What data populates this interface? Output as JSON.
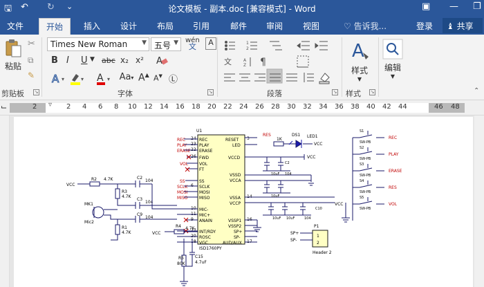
{
  "titlebar": {
    "title": "论文模板 - 副本.doc [兼容模式] - Word",
    "save_glyph": "🖫",
    "undo_glyph": "↶",
    "redo_glyph": "↻",
    "customize_glyph": "⌄",
    "ribbon_display_glyph": "▣",
    "minimize_glyph": "—",
    "restore_glyph": "❐"
  },
  "tabs": [
    "文件",
    "开始",
    "插入",
    "设计",
    "布局",
    "引用",
    "邮件",
    "审阅",
    "视图"
  ],
  "active_tab": "开始",
  "tell_me": "♡ 告诉我...",
  "signin": "登录",
  "share": "共享",
  "clipboard": {
    "paste": "粘贴",
    "group": "剪贴板"
  },
  "font": {
    "name": "Times New Roman",
    "size": "五号",
    "wen": "wén",
    "group": "字体",
    "bold": "B",
    "italic": "I",
    "underline": "U",
    "strike": "abc",
    "sub": "x₂",
    "sup": "x²",
    "fontcolor": "A",
    "case": "Aa",
    "grow": "A",
    "shrink": "A"
  },
  "paragraph": {
    "group": "段落"
  },
  "styles": {
    "label": "样式",
    "group": "样式"
  },
  "editing": {
    "label": "编辑"
  },
  "ruler_numbers": [
    "2",
    "2",
    "4",
    "6",
    "8",
    "10",
    "12",
    "14",
    "16",
    "18",
    "20",
    "22",
    "24",
    "26",
    "28",
    "30",
    "32",
    "34",
    "36",
    "38",
    "40",
    "42",
    "44",
    "46",
    "48"
  ],
  "schematic": {
    "chip_name": "U1",
    "chip_part": "ISD1760PY",
    "left_pins": [
      {
        "num": "24",
        "name": "REC",
        "net": "REC"
      },
      {
        "num": "23",
        "name": "PLAY",
        "net": "PLAY"
      },
      {
        "num": "22",
        "name": "ERASE",
        "net": "ERASE"
      },
      {
        "num": "26",
        "name": "FWD",
        "net": ""
      },
      {
        "num": "",
        "name": "VOL",
        "net": "VOL"
      },
      {
        "num": "",
        "name": "FT",
        "net": ""
      },
      {
        "num": "",
        "name": "SS",
        "net": "SS"
      },
      {
        "num": "6",
        "name": "SCLK",
        "net": "SCLK"
      },
      {
        "num": "",
        "name": "MOSI",
        "net": "MOSI"
      },
      {
        "num": "",
        "name": "MISO",
        "net": "MISO"
      },
      {
        "num": "10",
        "name": "MIC-",
        "net": ""
      },
      {
        "num": "11",
        "name": "MIC+",
        "net": ""
      },
      {
        "num": "9",
        "name": "ANAIN",
        "net": ""
      },
      {
        "num": "27",
        "name": "INT/RDY",
        "net": ""
      },
      {
        "num": "20",
        "name": "ROSC",
        "net": ""
      },
      {
        "num": "18",
        "name": "VGC",
        "net": ""
      }
    ],
    "right_pins": [
      {
        "num": "3",
        "name": "RESET"
      },
      {
        "num": "",
        "name": "LED"
      },
      {
        "num": "",
        "name": "VCCD"
      },
      {
        "num": "",
        "name": "VSSD"
      },
      {
        "num": "",
        "name": "VCCA"
      },
      {
        "num": "14",
        "name": "VSSA"
      },
      {
        "num": "",
        "name": "VCCP"
      },
      {
        "num": "16",
        "name": "VSSP1"
      },
      {
        "num": "",
        "name": "VSSP2"
      },
      {
        "num": "",
        "name": "SP+"
      },
      {
        "num": "",
        "name": "SP-"
      },
      {
        "num": "17",
        "name": "AUD/AUX"
      }
    ],
    "labels": {
      "vcc": "VCC",
      "r2": "R2",
      "r2v": "4.7K",
      "r3": "R3",
      "r3v": "4.7K",
      "r1": "R1",
      "r1v": "4.7K",
      "c2": "C2",
      "c2v": "104",
      "c3": "C3",
      "c3v": "104",
      "c9": "C9",
      "c9v": "104",
      "mk1": "MK1",
      "mic": "Mic2",
      "r4": "R4",
      "r4v": "4.7K",
      "r5": "R5",
      "r5v": "80K",
      "c15": "C15",
      "c15v": "4.7uF",
      "res": "RES",
      "r1k": "1K",
      "ds1": "DS1",
      "led": "LED1",
      "cap1": "10uF",
      "cap2": "104",
      "cap3": "10uF",
      "cap4": "10uF",
      "cap5": "104",
      "cap6": "10uF",
      "c10": "C10",
      "p1": "P1",
      "header": "Header 2",
      "spp": "SP+",
      "spn": "SP-",
      "vcc2": "VCC"
    },
    "switches": [
      {
        "name": "S1",
        "label": "REC",
        "type": "SW-PB"
      },
      {
        "name": "S2",
        "label": "PLAY",
        "type": "SW-PB"
      },
      {
        "name": "S3",
        "label": "ERASE",
        "type": "SW-PB"
      },
      {
        "name": "S4",
        "label": "RES",
        "type": "SW-PB"
      },
      {
        "name": "S5",
        "label": "VOL",
        "type": "SW-PB"
      }
    ]
  },
  "colors": {
    "ribbon_blue": "#2b579a",
    "chip_fill": "#ffffc4",
    "net_red": "#c00000",
    "wire_dark": "#1a1a6a"
  }
}
